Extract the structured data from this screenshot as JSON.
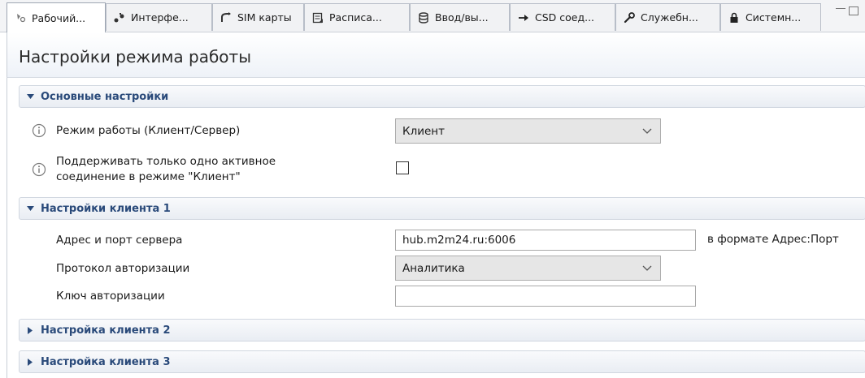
{
  "tabs": [
    {
      "label": "Рабочий...",
      "icon": "settings-network-icon",
      "active": true
    },
    {
      "label": "Интерфе...",
      "icon": "interface-icon",
      "active": false
    },
    {
      "label": "SIM карты",
      "icon": "sim-icon",
      "active": false
    },
    {
      "label": "Расписа...",
      "icon": "schedule-icon",
      "active": false
    },
    {
      "label": "Ввод/вы...",
      "icon": "database-icon",
      "active": false
    },
    {
      "label": "CSD соед...",
      "icon": "arrow-right-icon",
      "active": false
    },
    {
      "label": "Служебн...",
      "icon": "wrench-icon",
      "active": false
    },
    {
      "label": "Системн...",
      "icon": "lock-icon",
      "active": false
    }
  ],
  "page": {
    "title": "Настройки режима работы"
  },
  "sections": {
    "basic": {
      "title": "Основные настройки",
      "mode_label": "Режим работы (Клиент/Сервер)",
      "mode_value": "Клиент",
      "single_conn_label_1": "Поддерживать только одно активное",
      "single_conn_label_2": "соединение в режиме \"Клиент\"",
      "single_conn_checked": false
    },
    "client1": {
      "title": "Настройки клиента 1",
      "addr_label": "Адрес и порт сервера",
      "addr_value": "hub.m2m24.ru:6006",
      "addr_hint": "в формате Адрес:Порт",
      "auth_proto_label": "Протокол авторизации",
      "auth_proto_value": "Аналитика",
      "auth_key_label": "Ключ авторизации",
      "auth_key_value": ""
    },
    "client2": {
      "title": "Настройка клиента 2"
    },
    "client3": {
      "title": "Настройка клиента 3"
    }
  },
  "colors": {
    "section_title": "#2a4a7a",
    "select_bg": "#e6e6e6"
  }
}
